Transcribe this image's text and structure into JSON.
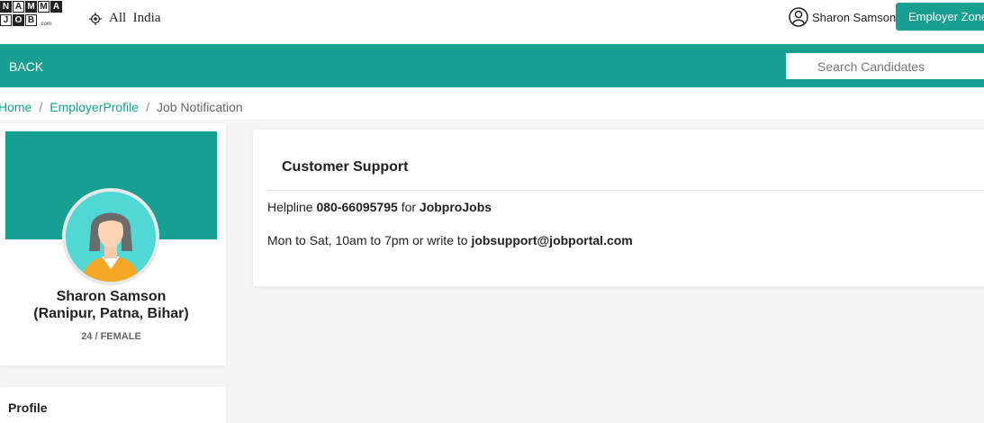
{
  "logo": {
    "row1": [
      "N",
      "A",
      "M",
      "M",
      "A"
    ],
    "row2": [
      "J",
      "O",
      "B"
    ],
    "suffix": ".com"
  },
  "header": {
    "location": "All  India",
    "user_name": "Sharon Samson",
    "employer_button": "Employer Zone"
  },
  "nav": {
    "back_label": "BACK",
    "search_placeholder": "Search Candidates"
  },
  "breadcrumb": {
    "home": "Home",
    "employer_profile": "EmployerProfile",
    "current": "Job Notification",
    "separator": "/"
  },
  "profile": {
    "name": "Sharon Samson",
    "location": "(Ranipur, Patna, Bihar)",
    "meta": "24 / FEMALE",
    "section_title": "Profile"
  },
  "support": {
    "title": "Customer Support",
    "helpline_prefix": "Helpline",
    "helpline_number": "080-66095795",
    "helpline_mid": "for",
    "brand": "JobproJobs",
    "hours_text": "Mon to Sat, 10am to 7pm or write to",
    "email": "jobsupport@jobportal.com"
  },
  "colors": {
    "accent": "#17a092",
    "avatar_bg": "#4fd8d4"
  }
}
